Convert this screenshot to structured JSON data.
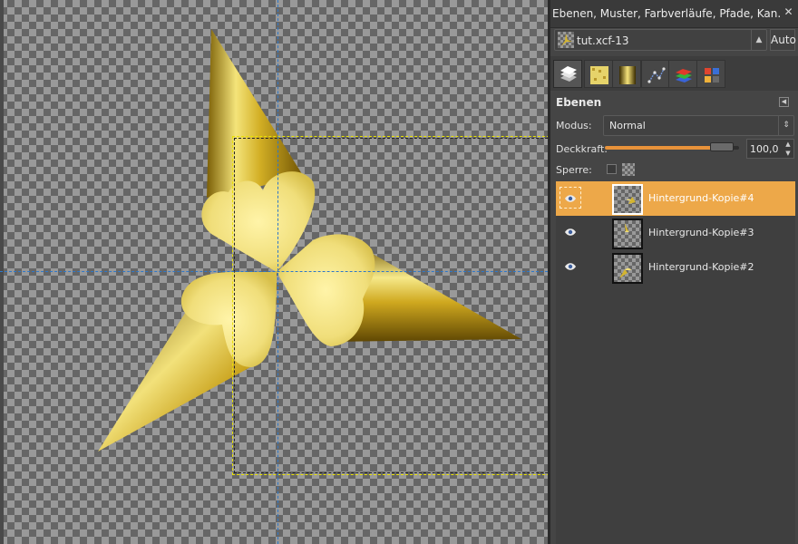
{
  "canvas": {
    "guides": [
      "horizontal",
      "vertical"
    ],
    "content": "gold-star",
    "gold_colors": [
      "#fff3a0",
      "#d9b72c",
      "#8a6a06",
      "#e9d86c"
    ]
  },
  "dock": {
    "title": "Ebenen, Muster, Farbverläufe, Pfade, Kan...",
    "close_icon": "close-icon",
    "image_name": "tut.xcf-13",
    "auto_label": "Auto",
    "tabs": [
      {
        "icon": "layers-icon",
        "active": true
      },
      {
        "icon": "patterns-icon",
        "active": false
      },
      {
        "icon": "gradients-icon",
        "active": false
      },
      {
        "icon": "paths-icon",
        "active": false
      },
      {
        "icon": "channels-icon",
        "active": false
      },
      {
        "icon": "palettes-icon",
        "active": false
      }
    ]
  },
  "layers_panel": {
    "heading": "Ebenen",
    "mode_label": "Modus:",
    "mode_value": "Normal",
    "opacity_label": "Deckkraft:",
    "opacity_value": "100,0",
    "opacity_fraction": 0.95,
    "lock_label": "Sperre:",
    "accent_color": "#e8923a",
    "layers": [
      {
        "name": "Hintergrund-Kopie#4",
        "visible": true,
        "selected": true
      },
      {
        "name": "Hintergrund-Kopie#3",
        "visible": true,
        "selected": false
      },
      {
        "name": "Hintergrund-Kopie#2",
        "visible": true,
        "selected": false
      }
    ]
  }
}
